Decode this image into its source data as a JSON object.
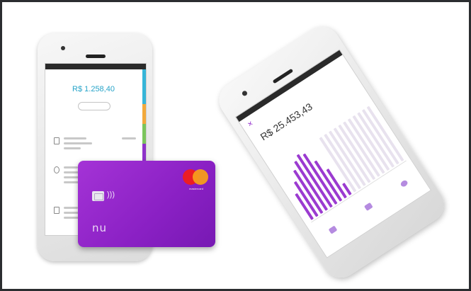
{
  "phone_left": {
    "balance": "R$ 1.258,40",
    "colors": {
      "accent": "#27a4c9"
    }
  },
  "card": {
    "brand_text": "mastercard",
    "colors": {
      "card_bg": "#9a2ccf",
      "mc_red": "#eb1d25",
      "mc_yellow": "#f79e1b"
    }
  },
  "phone_right": {
    "balance": "R$ 25.453,43",
    "chart_bars": [
      {
        "value": 0.45,
        "highlight": true
      },
      {
        "value": 0.6,
        "highlight": true
      },
      {
        "value": 0.75,
        "highlight": true
      },
      {
        "value": 0.85,
        "highlight": true
      },
      {
        "value": 0.92,
        "highlight": true
      },
      {
        "value": 0.88,
        "highlight": true
      },
      {
        "value": 0.7,
        "highlight": true
      },
      {
        "value": 0.5,
        "highlight": true
      },
      {
        "value": 0.2,
        "highlight": true
      },
      {
        "value": 0.95,
        "highlight": false
      },
      {
        "value": 0.95,
        "highlight": false
      },
      {
        "value": 0.95,
        "highlight": false
      },
      {
        "value": 0.95,
        "highlight": false
      },
      {
        "value": 0.95,
        "highlight": false
      },
      {
        "value": 0.95,
        "highlight": false
      },
      {
        "value": 0.95,
        "highlight": false
      },
      {
        "value": 0.95,
        "highlight": false
      },
      {
        "value": 0.95,
        "highlight": false
      },
      {
        "value": 0.95,
        "highlight": false
      },
      {
        "value": 0.95,
        "highlight": false
      }
    ],
    "colors": {
      "bar_active": "#9b3bd0",
      "bar_inactive": "#e8e2ee",
      "limit_green": "#4bbd5a"
    }
  }
}
